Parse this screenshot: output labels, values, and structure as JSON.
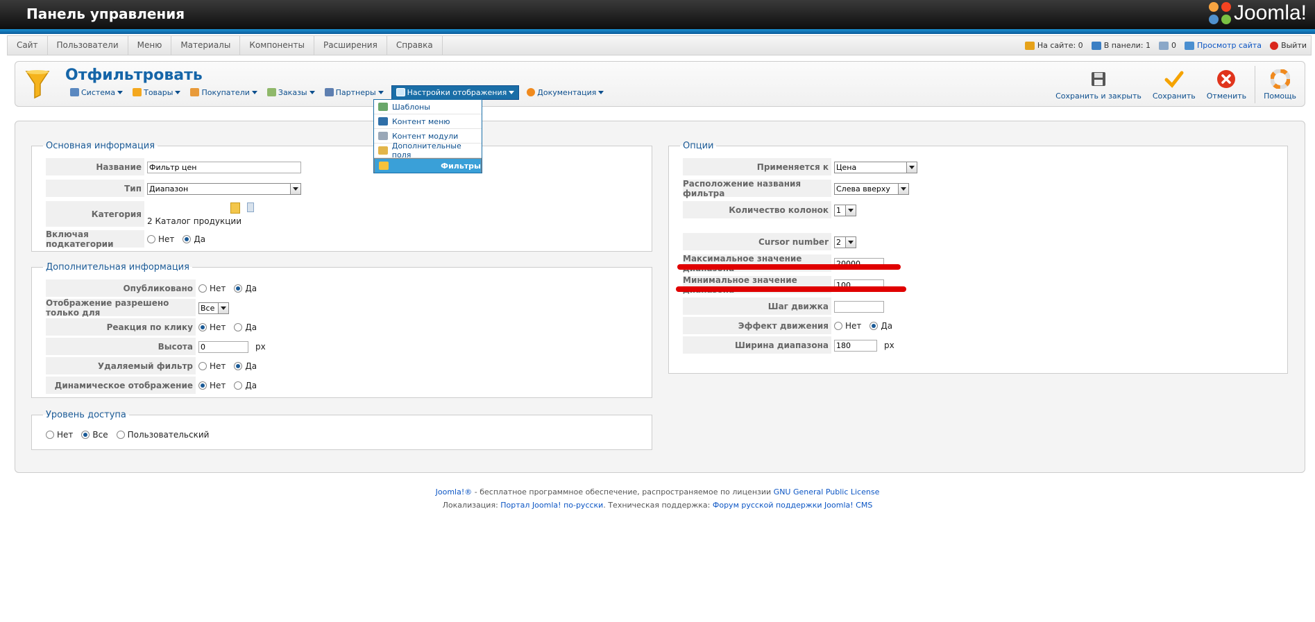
{
  "header": {
    "title": "Панель управления",
    "logo": "Joomla!"
  },
  "menu": [
    "Сайт",
    "Пользователи",
    "Меню",
    "Материалы",
    "Компоненты",
    "Расширения",
    "Справка"
  ],
  "status": {
    "on_site": "На сайте: 0",
    "in_panel": "В панели: 1",
    "messages": "0",
    "view_site": "Просмотр сайта",
    "logout": "Выйти"
  },
  "page": {
    "title": "Отфильтровать"
  },
  "submenu": [
    "Система",
    "Товары",
    "Покупатели",
    "Заказы",
    "Партнеры",
    "Настройки отображения",
    "Документация"
  ],
  "dropdown": [
    "Шаблоны",
    "Контент меню",
    "Контент модули",
    "Дополнительные поля",
    "Фильтры"
  ],
  "toolbar": {
    "save_close": "Сохранить и закрыть",
    "save": "Сохранить",
    "cancel": "Отменить",
    "help": "Помощь"
  },
  "basic": {
    "legend": "Основная информация",
    "name_label": "Название",
    "name_value": "Фильтр цен",
    "type_label": "Тип",
    "type_value": "Диапазон",
    "category_label": "Категория",
    "category_value": "2 Каталог продукции",
    "subcat_label": "Включая подкатегории",
    "no": "Нет",
    "yes": "Да"
  },
  "extra": {
    "legend": "Дополнительная информация",
    "published_label": "Опубликовано",
    "display_only_label": "Отображение разрешено только для",
    "display_only_value": "Все",
    "click_label": "Реакция по клику",
    "height_label": "Высота",
    "height_value": "0",
    "height_unit": "px",
    "removable_label": "Удаляемый фильтр",
    "dynamic_label": "Динамическое отображение",
    "no": "Нет",
    "yes": "Да"
  },
  "access": {
    "legend": "Уровень доступа",
    "opt_no": "Нет",
    "opt_all": "Все",
    "opt_custom": "Пользовательский"
  },
  "options": {
    "legend": "Опции",
    "applies_label": "Применяется к",
    "applies_value": "Цена",
    "position_label": "Расположение названия фильтра",
    "position_value": "Слева вверху",
    "columns_label": "Количество колонок",
    "columns_value": "1",
    "cursor_label": "Cursor number",
    "cursor_value": "2",
    "max_label": "Максимальное значение диапазона",
    "max_value": "20000",
    "min_label": "Минимальное значение диапазона",
    "min_value": "100",
    "step_label": "Шаг движка",
    "step_value": "",
    "effect_label": "Эффект движения",
    "width_label": "Ширина диапазона",
    "width_value": "180",
    "width_unit": "px",
    "no": "Нет",
    "yes": "Да"
  },
  "footer": {
    "line1_link": "Joomla!®",
    "line1_text": " - бесплатное программное обеспечение, распространяемое по лицензии ",
    "line1_license": "GNU General Public License",
    "line2_text1": "Локализация: ",
    "line2_link1": "Портал Joomla! по-русски",
    "line2_text2": ". Техническая поддержка: ",
    "line2_link2": "Форум русской поддержки Joomla! CMS"
  }
}
